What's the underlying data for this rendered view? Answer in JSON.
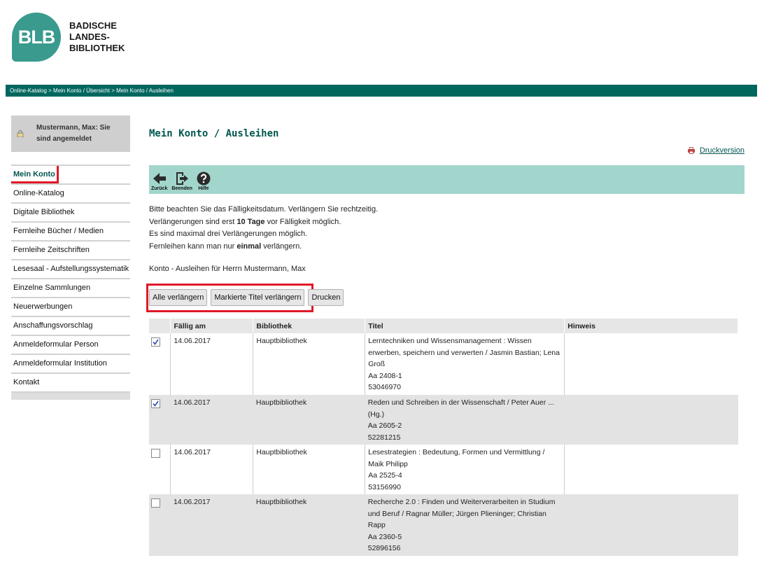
{
  "header": {
    "logo_abbr": "BLB",
    "logo_text": [
      "BADISCHE",
      "LANDES-",
      "BIBLIOTHEK"
    ]
  },
  "breadcrumb": "Online-Katalog > Mein Konto / Übersicht > Mein Konto / Ausleihen",
  "sidebar": {
    "user_status": "Mustermann, Max: Sie sind angemeldet",
    "items": [
      {
        "label": "Mein Konto",
        "active": true
      },
      {
        "label": "Online-Katalog"
      },
      {
        "label": "Digitale Bibliothek"
      },
      {
        "label": "Fernleihe Bücher / Medien"
      },
      {
        "label": "Fernleihe Zeitschriften"
      },
      {
        "label": "Lesesaal - Aufstellungssystematik"
      },
      {
        "label": "Einzelne Sammlungen"
      },
      {
        "label": "Neuerwerbungen"
      },
      {
        "label": "Anschaffungsvorschlag"
      },
      {
        "label": "Anmeldeformular Person"
      },
      {
        "label": "Anmeldeformular Institution"
      },
      {
        "label": "Kontakt"
      }
    ]
  },
  "main": {
    "title": "Mein Konto / Ausleihen",
    "print_version": "Druckversion",
    "toolbar": {
      "back": "Zurück",
      "exit": "Beenden",
      "help": "Hilfe"
    },
    "notes": {
      "line1": "Bitte beachten Sie das Fälligkeitsdatum. Verlängern Sie rechtzeitig.",
      "line2_pre": "Verlängerungen sind erst ",
      "line2_bold": "10 Tage",
      "line2_post": " vor Fälligkeit möglich.",
      "line3": "Es sind maximal drei Verlängerungen möglich.",
      "line4_pre": "Fernleihen kann man nur ",
      "line4_bold": "einmal",
      "line4_post": " verlängern."
    },
    "account_label": "Konto - Ausleihen für Herrn Mustermann, Max",
    "buttons": {
      "renew_all": "Alle verlängern",
      "renew_marked": "Markierte Titel verlängern",
      "print": "Drucken"
    },
    "table": {
      "headers": [
        "",
        "Fällig am",
        "Bibliothek",
        "Titel",
        "Hinweis"
      ],
      "rows": [
        {
          "checked": true,
          "due": "14.06.2017",
          "library": "Hauptbibliothek",
          "title": [
            "Lerntechniken und Wissensmanagement : Wissen",
            "erwerben, speichern und verwerten / Jasmin Bastian; Lena",
            "Groß",
            "Aa 2408-1",
            "53046970"
          ],
          "note": ""
        },
        {
          "checked": true,
          "due": "14.06.2017",
          "library": "Hauptbibliothek",
          "title": [
            "Reden und Schreiben in der Wissenschaft / Peter Auer ...",
            "(Hg.)",
            "Aa 2605-2",
            "52281215"
          ],
          "note": ""
        },
        {
          "checked": false,
          "due": "14.06.2017",
          "library": "Hauptbibliothek",
          "title": [
            "Lesestrategien : Bedeutung, Formen und Vermittlung /",
            "Maik Philipp",
            "Aa 2525-4",
            "53156990"
          ],
          "note": ""
        },
        {
          "checked": false,
          "due": "14.06.2017",
          "library": "Hauptbibliothek",
          "title": [
            "Recherche 2.0 : Finden und Weiterverarbeiten in Studium",
            "und Beruf / Ragnar Müller; Jürgen Plieninger; Christian",
            "Rapp",
            "Aa 2360-5",
            "52896156"
          ],
          "note": ""
        }
      ]
    }
  }
}
